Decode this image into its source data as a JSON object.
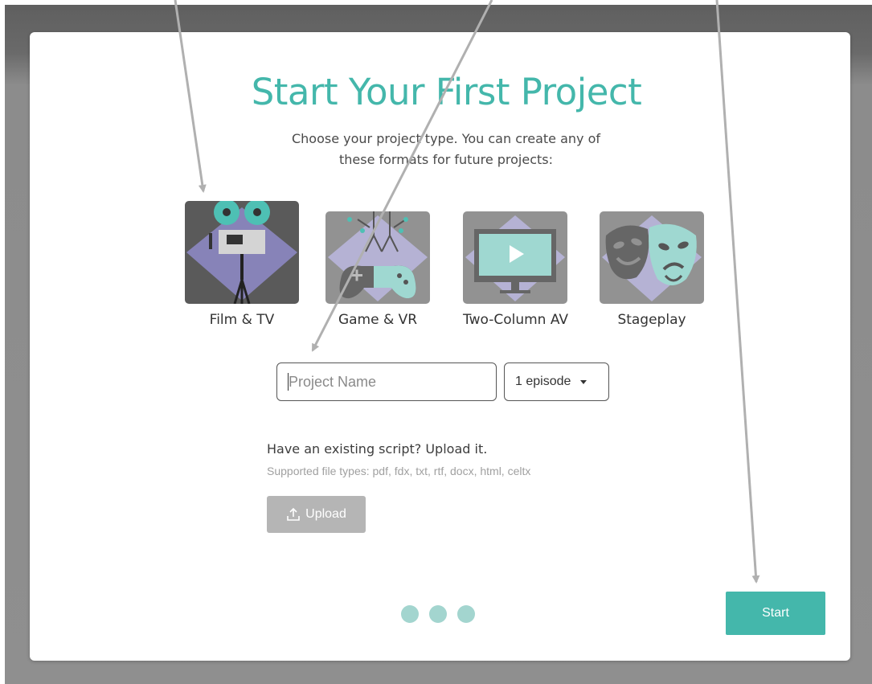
{
  "modal": {
    "title": "Start Your First Project",
    "subtitle_line1": "Choose your project type. You can create any of",
    "subtitle_line2": "these formats for future projects:"
  },
  "project_types": [
    {
      "label": "Film & TV",
      "icon": "film-camera-icon",
      "selected": true
    },
    {
      "label": "Game & VR",
      "icon": "game-controller-icon",
      "selected": false
    },
    {
      "label": "Two-Column AV",
      "icon": "monitor-play-icon",
      "selected": false
    },
    {
      "label": "Stageplay",
      "icon": "theater-masks-icon",
      "selected": false
    }
  ],
  "form": {
    "name_placeholder": "Project Name",
    "name_value": "",
    "episodes_selected": "1 episode"
  },
  "upload": {
    "heading": "Have an existing script? Upload it.",
    "supported": "Supported file types: pdf, fdx, txt, rtf, docx, html, celtx",
    "button_label": "Upload",
    "button_icon": "upload-icon"
  },
  "pagination": {
    "total_steps": 3
  },
  "footer": {
    "start_label": "Start"
  },
  "colors": {
    "accent": "#44b7ab",
    "dot": "#a3d5cf",
    "tile_bg": "#929292",
    "diamond": "#b5b2d4"
  }
}
